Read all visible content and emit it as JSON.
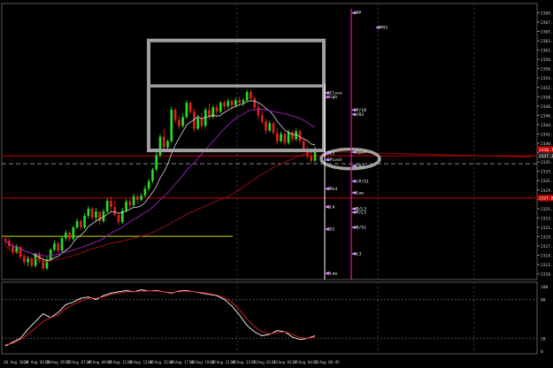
{
  "chart_data": [
    {
      "type": "candlestick",
      "title": "",
      "xlabel": "",
      "ylabel": "",
      "ylim": [
        2309.5,
        2371.5
      ],
      "y_ticks": [
        "2371.52",
        "2369.43",
        "2367.33",
        "2365.24",
        "2363.15",
        "2361.04",
        "2358.95",
        "2356.86",
        "2354.76",
        "2352.67",
        "2350.57",
        "2348.47",
        "2346.38",
        "2344.29",
        "2342.19",
        "2340.10",
        "2338.00",
        "2335.90",
        "2333.81",
        "2331.71",
        "2329.62",
        "2327.53",
        "2325.43",
        "2323.34",
        "2321.24",
        "2319.15",
        "2317.05",
        "2314.96",
        "2312.86",
        "2310.76"
      ],
      "x_ticks": [
        "20 Aug 2024",
        "20 Aug 03:20",
        "20 Aug 05:25",
        "20 Aug 07:45",
        "20 Aug 09:45",
        "20 Aug 11:45",
        "20 Aug 13:45",
        "20 Aug 15:45",
        "20 Aug 17:45",
        "20 Aug 19:45",
        "20 Aug 21:45",
        "20 Aug 23:45",
        "21 Aug 01:45",
        "21 Aug 03:45",
        "21 Aug 04:45",
        "21 Aug 06:45"
      ],
      "price_labels": [
        {
          "text": "2338.74",
          "color": "#c00000"
        },
        {
          "text": "2337.30",
          "color": "#1f1f1f"
        },
        {
          "text": "2327.84",
          "color": "#c00000"
        }
      ],
      "candles": [
        [
          2318.6,
          2319.4,
          2317.2,
          2318.2
        ],
        [
          2318.2,
          2318.8,
          2316.4,
          2317.0
        ],
        [
          2317.0,
          2317.8,
          2315.0,
          2315.6
        ],
        [
          2315.6,
          2317.4,
          2315.2,
          2316.8
        ],
        [
          2316.8,
          2317.2,
          2314.0,
          2314.6
        ],
        [
          2314.6,
          2315.2,
          2312.8,
          2313.4
        ],
        [
          2313.4,
          2314.8,
          2312.4,
          2314.2
        ],
        [
          2314.2,
          2314.6,
          2312.0,
          2312.6
        ],
        [
          2312.6,
          2315.6,
          2312.2,
          2315.2
        ],
        [
          2315.2,
          2315.8,
          2313.2,
          2313.8
        ],
        [
          2313.8,
          2314.4,
          2311.4,
          2312.0
        ],
        [
          2312.0,
          2314.6,
          2311.6,
          2314.0
        ],
        [
          2314.0,
          2316.6,
          2313.6,
          2316.2
        ],
        [
          2316.2,
          2318.2,
          2315.8,
          2317.6
        ],
        [
          2317.6,
          2318.0,
          2315.4,
          2316.0
        ],
        [
          2316.0,
          2319.2,
          2315.6,
          2318.8
        ],
        [
          2318.8,
          2320.6,
          2318.2,
          2320.0
        ],
        [
          2320.0,
          2320.4,
          2318.0,
          2318.6
        ],
        [
          2318.6,
          2321.6,
          2318.2,
          2321.2
        ],
        [
          2321.2,
          2323.2,
          2320.8,
          2322.6
        ],
        [
          2322.6,
          2323.0,
          2320.6,
          2321.2
        ],
        [
          2321.2,
          2324.4,
          2320.8,
          2323.8
        ],
        [
          2323.8,
          2326.0,
          2323.2,
          2325.4
        ],
        [
          2325.4,
          2325.8,
          2322.8,
          2323.4
        ],
        [
          2323.4,
          2325.6,
          2322.6,
          2324.8
        ],
        [
          2324.8,
          2324.8,
          2321.8,
          2322.6
        ],
        [
          2322.6,
          2325.4,
          2322.2,
          2324.8
        ],
        [
          2324.8,
          2327.8,
          2324.4,
          2327.2
        ],
        [
          2327.2,
          2328.2,
          2324.8,
          2325.8
        ],
        [
          2325.8,
          2327.2,
          2323.6,
          2324.0
        ],
        [
          2324.0,
          2324.6,
          2321.8,
          2322.4
        ],
        [
          2322.4,
          2325.6,
          2322.0,
          2325.0
        ],
        [
          2325.0,
          2327.6,
          2324.6,
          2327.0
        ],
        [
          2327.0,
          2327.6,
          2325.6,
          2326.2
        ],
        [
          2326.2,
          2328.8,
          2325.8,
          2328.2
        ],
        [
          2328.2,
          2328.8,
          2326.6,
          2327.4
        ],
        [
          2327.4,
          2329.0,
          2327.0,
          2328.4
        ],
        [
          2328.4,
          2330.6,
          2328.0,
          2329.9
        ],
        [
          2329.9,
          2332.2,
          2329.4,
          2331.6
        ],
        [
          2331.6,
          2334.6,
          2331.2,
          2334.2
        ],
        [
          2334.2,
          2338.0,
          2333.8,
          2337.4
        ],
        [
          2337.4,
          2342.2,
          2337.0,
          2341.6
        ],
        [
          2341.6,
          2343.4,
          2338.4,
          2339.2
        ],
        [
          2339.2,
          2341.0,
          2338.8,
          2340.6
        ],
        [
          2340.6,
          2348.4,
          2340.2,
          2347.6
        ],
        [
          2347.6,
          2348.0,
          2344.6,
          2345.4
        ],
        [
          2345.4,
          2346.2,
          2343.2,
          2344.0
        ],
        [
          2344.0,
          2346.8,
          2343.6,
          2346.0
        ],
        [
          2346.0,
          2349.8,
          2345.6,
          2349.2
        ],
        [
          2349.2,
          2349.6,
          2346.6,
          2347.2
        ],
        [
          2347.2,
          2348.0,
          2342.6,
          2343.4
        ],
        [
          2343.4,
          2346.6,
          2343.0,
          2345.8
        ],
        [
          2345.8,
          2347.0,
          2343.2,
          2344.0
        ],
        [
          2344.0,
          2348.2,
          2343.6,
          2347.6
        ],
        [
          2347.6,
          2349.0,
          2345.4,
          2346.0
        ],
        [
          2346.0,
          2348.6,
          2345.6,
          2348.2
        ],
        [
          2348.2,
          2348.8,
          2346.4,
          2347.2
        ],
        [
          2347.2,
          2349.6,
          2346.8,
          2349.2
        ],
        [
          2349.2,
          2349.8,
          2347.6,
          2348.4
        ],
        [
          2348.4,
          2350.2,
          2348.0,
          2349.6
        ],
        [
          2349.6,
          2350.0,
          2347.8,
          2348.6
        ],
        [
          2348.6,
          2350.4,
          2348.2,
          2349.8
        ],
        [
          2349.8,
          2350.6,
          2348.6,
          2349.2
        ],
        [
          2349.2,
          2350.2,
          2348.4,
          2349.8
        ],
        [
          2349.8,
          2352.2,
          2349.4,
          2351.6
        ],
        [
          2351.6,
          2352.2,
          2349.6,
          2350.2
        ],
        [
          2350.2,
          2350.6,
          2347.6,
          2348.2
        ],
        [
          2348.2,
          2349.0,
          2345.6,
          2346.4
        ],
        [
          2346.4,
          2347.4,
          2344.4,
          2345.0
        ],
        [
          2345.0,
          2345.6,
          2342.2,
          2343.0
        ],
        [
          2343.0,
          2345.2,
          2342.6,
          2344.6
        ],
        [
          2344.6,
          2345.0,
          2342.0,
          2342.4
        ],
        [
          2342.4,
          2343.6,
          2339.8,
          2340.6
        ],
        [
          2340.6,
          2342.8,
          2340.2,
          2342.2
        ],
        [
          2342.2,
          2342.6,
          2339.6,
          2340.2
        ],
        [
          2340.2,
          2343.2,
          2339.8,
          2342.6
        ],
        [
          2342.6,
          2343.0,
          2340.4,
          2341.0
        ],
        [
          2341.0,
          2343.4,
          2340.6,
          2342.8
        ],
        [
          2342.8,
          2343.2,
          2340.0,
          2340.6
        ],
        [
          2340.6,
          2341.2,
          2338.2,
          2338.8
        ],
        [
          2338.8,
          2339.4,
          2336.6,
          2337.2
        ],
        [
          2337.2,
          2338.0,
          2335.6,
          2336.2
        ],
        [
          2336.2,
          2339.4,
          2335.8,
          2338.9
        ]
      ],
      "levels": [
        {
          "price": 2337.3,
          "color": "#c00000",
          "style": "solid"
        },
        {
          "price": 2335.5,
          "color": "#888888",
          "style": "dashed"
        },
        {
          "price": 2327.84,
          "color": "#c00000",
          "style": "solid"
        },
        {
          "price": 2319.2,
          "color": "#d4d400",
          "style": "solid"
        }
      ],
      "level_tags": [
        {
          "text": "WPP",
          "price": 2369.4,
          "color": "#ffffff"
        },
        {
          "text": "DPH3",
          "price": 2366.1,
          "color": "#ffffff"
        },
        {
          "text": "DClose",
          "price": 2351.4,
          "color": "#ffffff"
        },
        {
          "text": "High",
          "price": 2350.5,
          "color": "#ffffff"
        },
        {
          "text": "WP/10",
          "price": 2347.6,
          "color": "#ffffff"
        },
        {
          "text": "W/R3",
          "price": 2346.6,
          "color": "#ffffff"
        },
        {
          "text": "DL3",
          "price": 2337.9,
          "color": "#ffffff"
        },
        {
          "text": "WOpen",
          "price": 2338.1,
          "color": "#ffffff"
        },
        {
          "text": "DPivot",
          "price": 2336.4,
          "color": "#ffffff"
        },
        {
          "text": "W/H3",
          "price": 2335.0,
          "color": "#ffffff"
        },
        {
          "text": "W/P/S1",
          "price": 2331.6,
          "color": "#ffffff"
        },
        {
          "text": "DMid",
          "price": 2329.9,
          "color": "#ffffff"
        },
        {
          "text": "WLow",
          "price": 2329.0,
          "color": "#ffffff"
        },
        {
          "text": "DL4",
          "price": 2325.8,
          "color": "#ffffff"
        },
        {
          "text": "WD/L3",
          "price": 2325.4,
          "color": "#ffffff"
        },
        {
          "text": "WP/L3",
          "price": 2324.6,
          "color": "#ffffff"
        },
        {
          "text": "DS1",
          "price": 2320.8,
          "color": "#ffffff"
        },
        {
          "text": "WD/S1",
          "price": 2321.2,
          "color": "#ffffff"
        },
        {
          "text": "WL3",
          "price": 2315.3,
          "color": "#ffffff"
        },
        {
          "text": "DLow",
          "price": 2310.9,
          "color": "#ffffff"
        }
      ]
    },
    {
      "type": "line",
      "title": "",
      "ylim": [
        0,
        100
      ],
      "y_ticks": [
        "100",
        "80",
        "20",
        "0"
      ],
      "series": [
        {
          "color": "#ffffff",
          "values": [
            8,
            14,
            20,
            34,
            46,
            58,
            52,
            60,
            72,
            76,
            82,
            84,
            80,
            86,
            90,
            92,
            94,
            92,
            95,
            93,
            94,
            92,
            90,
            93,
            94,
            92,
            90,
            88,
            86,
            80,
            70,
            56,
            40,
            30,
            24,
            26,
            32,
            30,
            22,
            18,
            20,
            24
          ]
        },
        {
          "color": "#e02020",
          "values": [
            10,
            12,
            18,
            26,
            36,
            46,
            52,
            56,
            66,
            72,
            78,
            82,
            82,
            84,
            88,
            90,
            92,
            92,
            93,
            93,
            93,
            92,
            91,
            92,
            93,
            92,
            91,
            89,
            87,
            83,
            76,
            64,
            50,
            38,
            30,
            27,
            29,
            30,
            26,
            21,
            20,
            22
          ]
        }
      ]
    }
  ]
}
